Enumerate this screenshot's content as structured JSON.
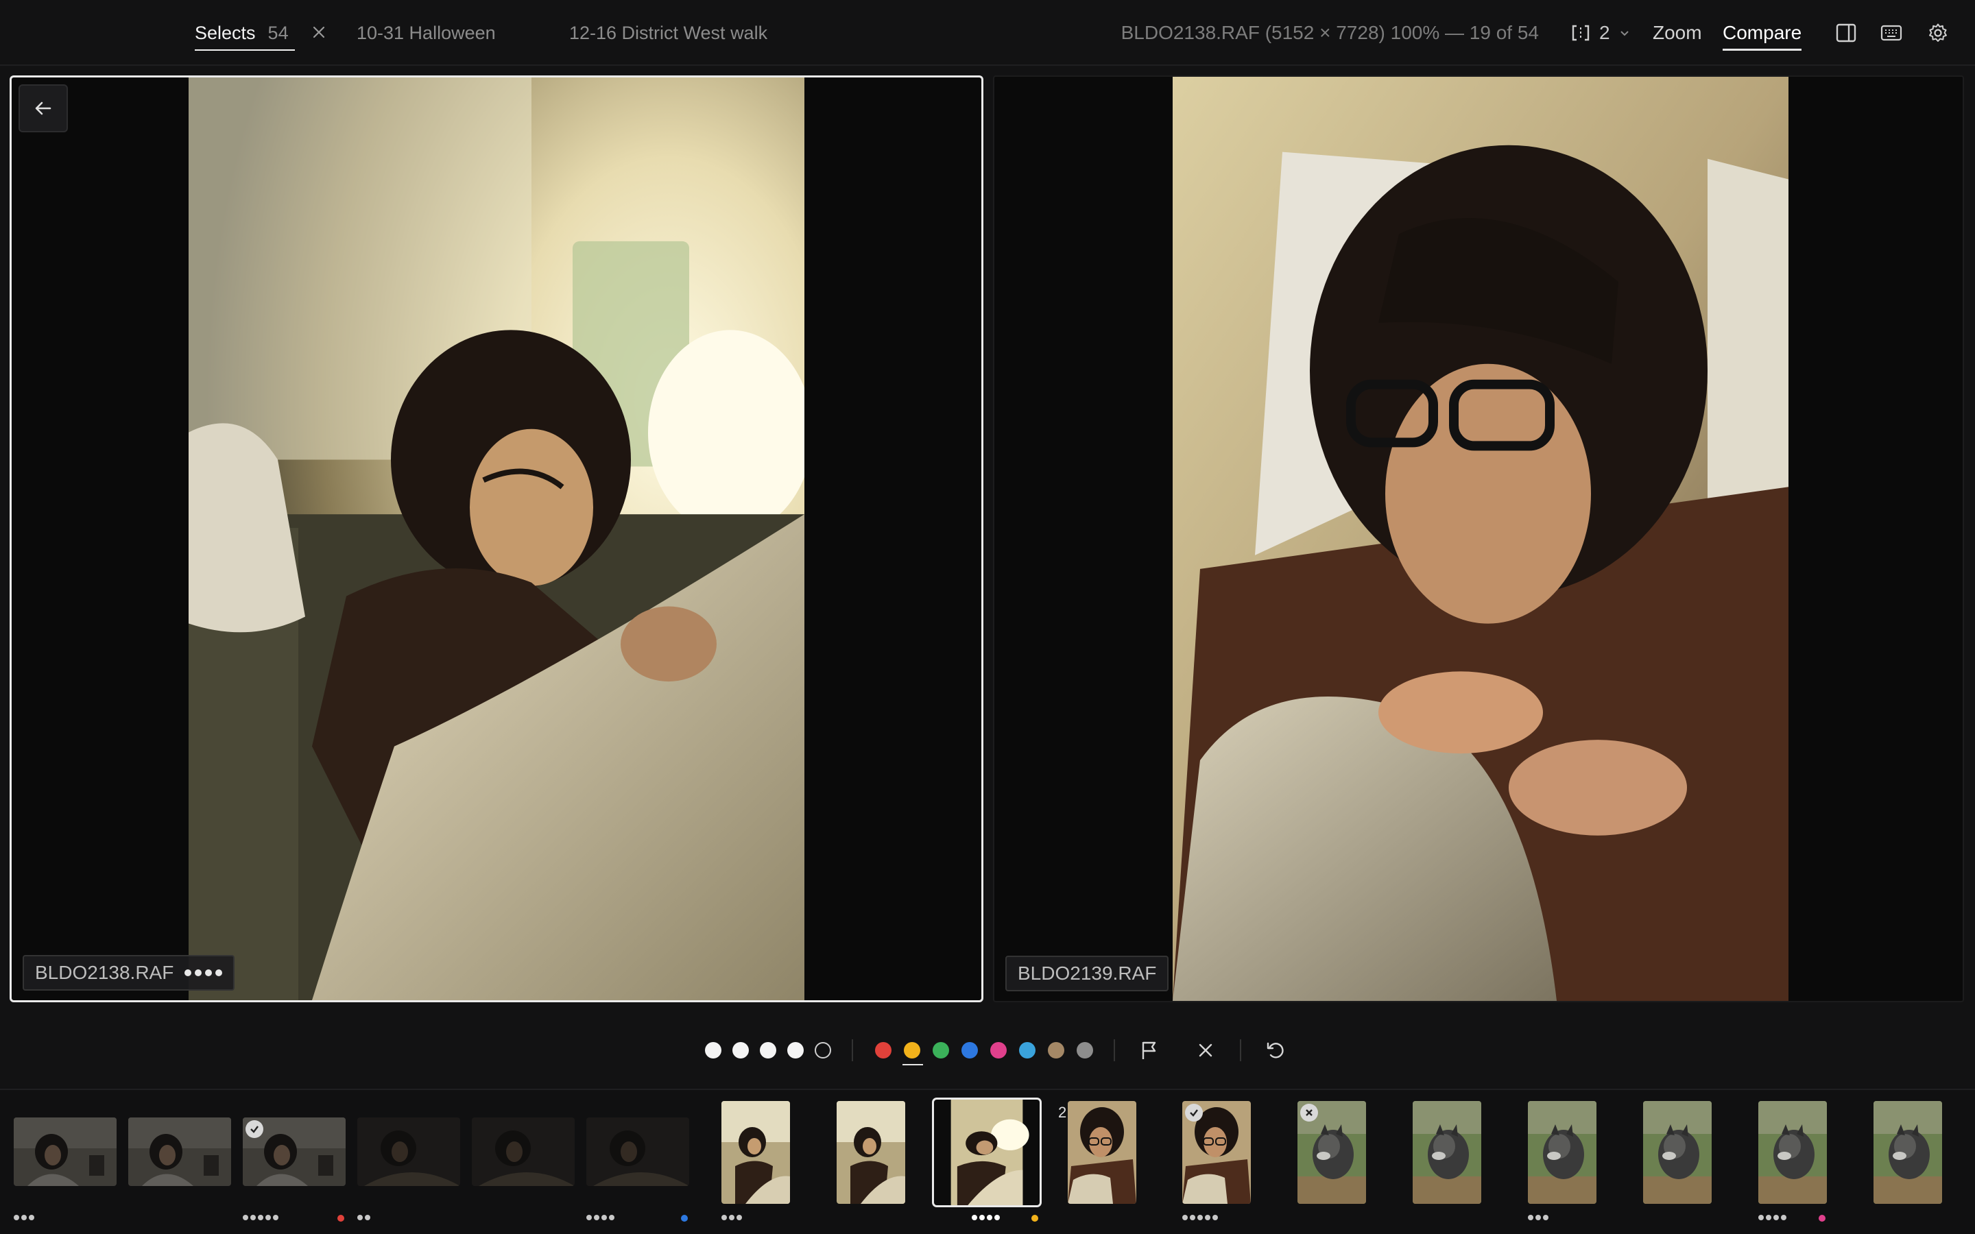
{
  "tabs": [
    {
      "label": "Selects",
      "count": "54"
    },
    {
      "label": "10-31 Halloween"
    },
    {
      "label": "12-16 District West walk"
    }
  ],
  "file_info": "BLDO2138.RAF (5152 × 7728) 100% — 19 of 54",
  "compare_count": "2",
  "zoom_label": "Zoom",
  "compare_label": "Compare",
  "left_pane": {
    "filename": "BLDO2138.RAF",
    "rating": 4
  },
  "right_pane": {
    "filename": "BLDO2139.RAF"
  },
  "rating": {
    "value": 4,
    "max": 5
  },
  "color_labels": [
    {
      "name": "red",
      "hex": "#e0413a"
    },
    {
      "name": "yellow",
      "hex": "#f2b21b",
      "selected": true
    },
    {
      "name": "green",
      "hex": "#3bb15a"
    },
    {
      "name": "blue",
      "hex": "#2d78e0"
    },
    {
      "name": "pink",
      "hex": "#e0408c"
    },
    {
      "name": "cyan",
      "hex": "#3aa3dc"
    },
    {
      "name": "tan",
      "hex": "#a48866"
    },
    {
      "name": "gray",
      "hex": "#8d8d8d"
    }
  ],
  "filmstrip": [
    {
      "subject": "girl-wide",
      "dimmed": true,
      "rating": 3
    },
    {
      "subject": "girl-wide",
      "dimmed": true,
      "rating": 0
    },
    {
      "subject": "girl-wide",
      "dimmed": true,
      "rating": 5,
      "picked": true,
      "color": "#e0413a"
    },
    {
      "subject": "girl-wide-dark",
      "dimmed": true,
      "rating": 2
    },
    {
      "subject": "girl-wide-dark",
      "dimmed": true,
      "rating": 0
    },
    {
      "subject": "girl-wide-dark",
      "dimmed": true,
      "rating": 4,
      "color": "#2d78e0"
    },
    {
      "subject": "girl-portrait",
      "rating": 3
    },
    {
      "subject": "girl-portrait",
      "rating": 0
    },
    {
      "subject": "girl-portrait-lamp",
      "rating": 4,
      "current": true,
      "color": "#f2b21b"
    },
    {
      "subject": "girl-close",
      "rating": 0,
      "compare_index": "2"
    },
    {
      "subject": "girl-close",
      "rating": 5,
      "picked": true
    },
    {
      "subject": "dog",
      "rating": 0,
      "rejected": true
    },
    {
      "subject": "dog",
      "rating": 0
    },
    {
      "subject": "dog",
      "rating": 3
    },
    {
      "subject": "dog",
      "rating": 0
    },
    {
      "subject": "dog",
      "rating": 4,
      "color": "#e0408c"
    },
    {
      "subject": "dog",
      "rating": 0
    }
  ]
}
